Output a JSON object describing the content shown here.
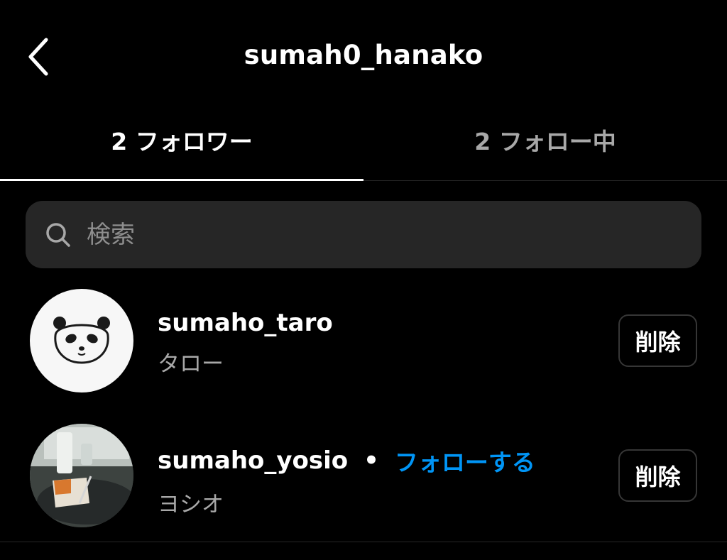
{
  "header": {
    "title": "sumah0_hanako",
    "back_icon": "chevron-left-icon"
  },
  "tabs": [
    {
      "label": "2 フォロワー",
      "active": true
    },
    {
      "label": "2 フォロー中",
      "active": false
    }
  ],
  "search": {
    "icon": "search-icon",
    "placeholder": "検索",
    "value": ""
  },
  "followers": [
    {
      "username": "sumaho_taro",
      "display_name": "タロー",
      "avatar": "panda-avatar",
      "follow_label": "",
      "remove_label": "削除"
    },
    {
      "username": "sumaho_yosio",
      "display_name": "ヨシオ",
      "avatar": "cafe-photo-avatar",
      "separator": "•",
      "follow_label": "フォローする",
      "remove_label": "削除"
    }
  ],
  "colors": {
    "background": "#000000",
    "text_primary": "#ffffff",
    "text_secondary": "#a8a8a8",
    "search_background": "#262626",
    "link_blue": "#0095f6"
  }
}
